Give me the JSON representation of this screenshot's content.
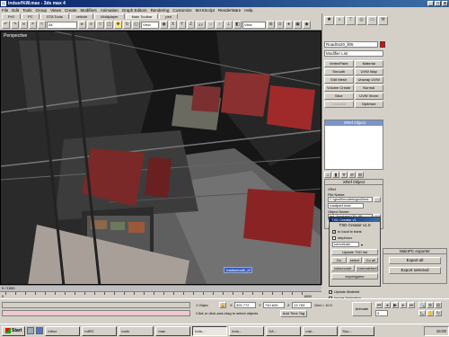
{
  "window": {
    "title": "indust%W.max - 3ds max 4",
    "minimize": "_",
    "maximize": "□",
    "close": "x"
  },
  "menu": [
    "File",
    "Edit",
    "Tools",
    "Group",
    "Views",
    "Create",
    "Modifiers",
    "Animation",
    "Graph Editors",
    "Rendering",
    "Customize",
    "MAXScript",
    "RenderWare",
    "Help"
  ],
  "tabs": [
    {
      "label": "PrO",
      "active": false
    },
    {
      "label": "PC",
      "active": false
    },
    {
      "label": "GTA Tools",
      "active": false
    },
    {
      "label": "vehicle",
      "active": false
    },
    {
      "label": "Multiplayer",
      "active": false
    },
    {
      "label": "Main Toolbar",
      "active": true
    },
    {
      "label": "ped",
      "active": false
    }
  ],
  "toolbar": {
    "selection_filter": "All",
    "ref_coord": "View",
    "axis_xy": "XY",
    "named_sel": "View"
  },
  "viewport": {
    "label": "Perspective",
    "selected_tag": "roadsmouth_dl"
  },
  "command_panel": {
    "object_name": "RoadSs20_ll05",
    "object_color": "#ff0000",
    "modifier_list": "Modifier List",
    "modifier_buttons": [
      {
        "label": "VertexPaint",
        "enabled": true
      },
      {
        "label": "Material",
        "enabled": true
      },
      {
        "label": "Smooth",
        "enabled": true
      },
      {
        "label": "UVW Map",
        "enabled": true
      },
      {
        "label": "Edit Mesh",
        "enabled": true
      },
      {
        "label": "Unwrap UVW",
        "enabled": true
      },
      {
        "label": "Volume Create",
        "enabled": true
      },
      {
        "label": "Normal",
        "enabled": true
      },
      {
        "label": "Slice",
        "enabled": true
      },
      {
        "label": "UVW Xform",
        "enabled": true
      },
      {
        "label": "Cascade",
        "enabled": false
      },
      {
        "label": "Optimize",
        "enabled": false
      }
    ],
    "stack_item": "XRef Object"
  },
  "xref": {
    "title": "XRef Object",
    "group": "XRef",
    "file_name_label": "File Name:",
    "file_name": "C:\\gtaIII\\models\\gta3\\ind...",
    "file_short": "roadpart.max",
    "object_name_label": "Object Name:",
    "object_name": "ind_fountainLOD_ll5",
    "update_label": "Update",
    "proxy_label": "Proxy"
  },
  "txd": {
    "title": "TXD Creator v1",
    "heading": "TXD Creator v1.0",
    "local_bank_label": "to local tx bank",
    "local_bank_checked": true,
    "stephnov_label": "stephnov",
    "stephnov_checked": false,
    "conv_value": "convxtudx",
    "update_label": "Update TXD list",
    "go_label": "Go",
    "select_label": "select",
    "go_all_label": "Go all",
    "colourcode_label": "colourcode",
    "unmatched_label": "Xunmatched",
    "exportgame_label": "exportgame",
    "update_material": "Update Material",
    "update_material_checked": true,
    "ignore_anim": "Ignore Animation",
    "ignore_anim_checked": false
  },
  "rw_exporter": {
    "title": "MainPC exporter",
    "export_all": "Export all",
    "export_selected": "Export selected"
  },
  "time": {
    "frame_display": "0 / 1500",
    "tick_start": "0",
    "tick_end": "1500"
  },
  "status": {
    "selected": "1 Objec",
    "x": "300.772",
    "y": "740.626",
    "z": "13.783",
    "grid": "Grid = 10.0",
    "prompt": "Click or click-and-drag to select objects",
    "add_time_tag": "Add Time Tag",
    "animate": "Animate",
    "frame": "0",
    "set_key": "Set Key"
  },
  "taskbar": {
    "start": "Start",
    "tasks": [
      {
        "label": "Inbox",
        "active": false
      },
      {
        "label": "mIRC",
        "active": false
      },
      {
        "label": "tools",
        "active": false
      },
      {
        "label": "max",
        "active": false
      },
      {
        "label": "indu...",
        "active": true
      },
      {
        "label": "indu...",
        "active": false
      },
      {
        "label": "SA...",
        "active": false
      },
      {
        "label": "mai...",
        "active": false
      },
      {
        "label": "Sou...",
        "active": false
      }
    ],
    "clock": "16:00"
  }
}
